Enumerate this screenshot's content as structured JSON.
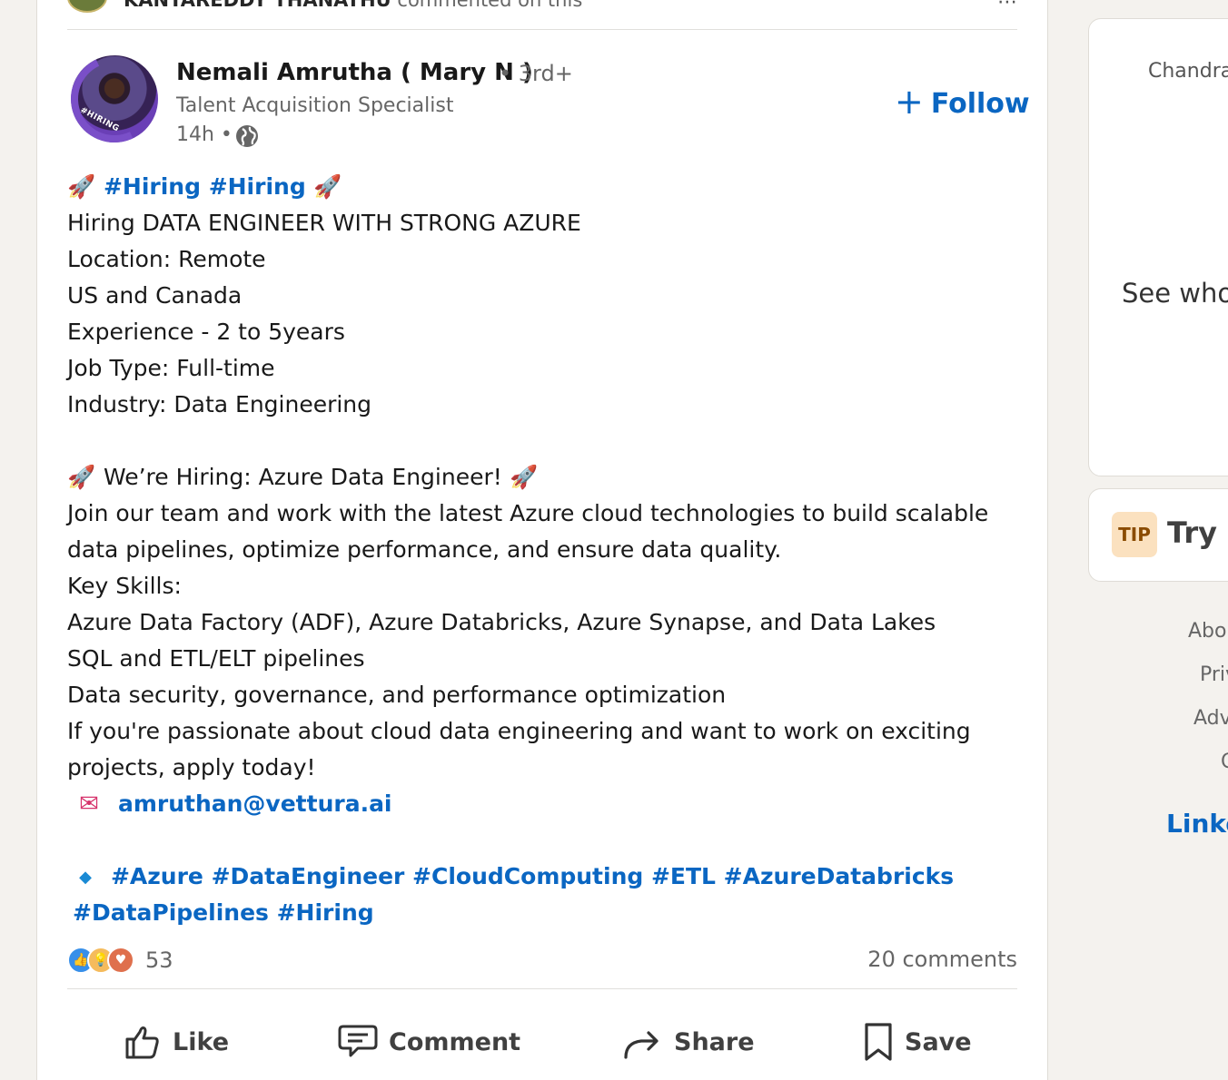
{
  "context": {
    "actor": "KANTAREDDY THANATHU",
    "action": "commented on this"
  },
  "post": {
    "author": {
      "name": "Nemali Amrutha ( Mary N )",
      "degree": "• 3rd+",
      "headline": "Talent Acquisition Specialist",
      "time": "14h •",
      "avatar_badge": "#HIRING"
    },
    "follow_label": "Follow",
    "body": {
      "hiring_tag": "#Hiring #Hiring",
      "line1": "Hiring DATA ENGINEER WITH STRONG AZURE",
      "line2": "Location: Remote",
      "line3": "US and Canada",
      "line4": "Experience - 2 to 5years",
      "line5": "Job Type: Full-time",
      "line6": "Industry: Data Engineering",
      "headline2": "We’re Hiring: Azure Data Engineer!",
      "para1a": "Join our team and work with the latest Azure cloud technologies to build scalable",
      "para1b": "data pipelines, optimize performance, and ensure data quality.",
      "skills_label": "Key Skills:",
      "skill1": "Azure Data Factory (ADF), Azure Databricks, Azure Synapse, and Data Lakes",
      "skill2": "SQL and ETL/ELT pipelines",
      "skill3": "Data security, governance, and performance optimization",
      "closing_a": "If you're passionate about cloud data engineering and want to work on exciting",
      "closing_b": "projects, apply today!",
      "email": "amruthan@vettura.ai",
      "tags_line1": "#Azure #DataEngineer #CloudComputing #ETL #AzureDatabricks",
      "tags_line2": "#DataPipelines #Hiring"
    },
    "reactions_count": "53",
    "comments_count": "20 comments",
    "actions": {
      "like": "Like",
      "comment": "Comment",
      "share": "Share",
      "save": "Save"
    }
  },
  "sidebar": {
    "card1_name": "Chandra",
    "card1_text": "See who’",
    "tip_badge": "TIP",
    "tip_text": "Try L",
    "footer": [
      "Abo",
      "Priv",
      "Adv",
      "C"
    ],
    "brand": "Linke"
  },
  "colors": {
    "link": "#0a66c2",
    "background": "#f4f2ee"
  }
}
